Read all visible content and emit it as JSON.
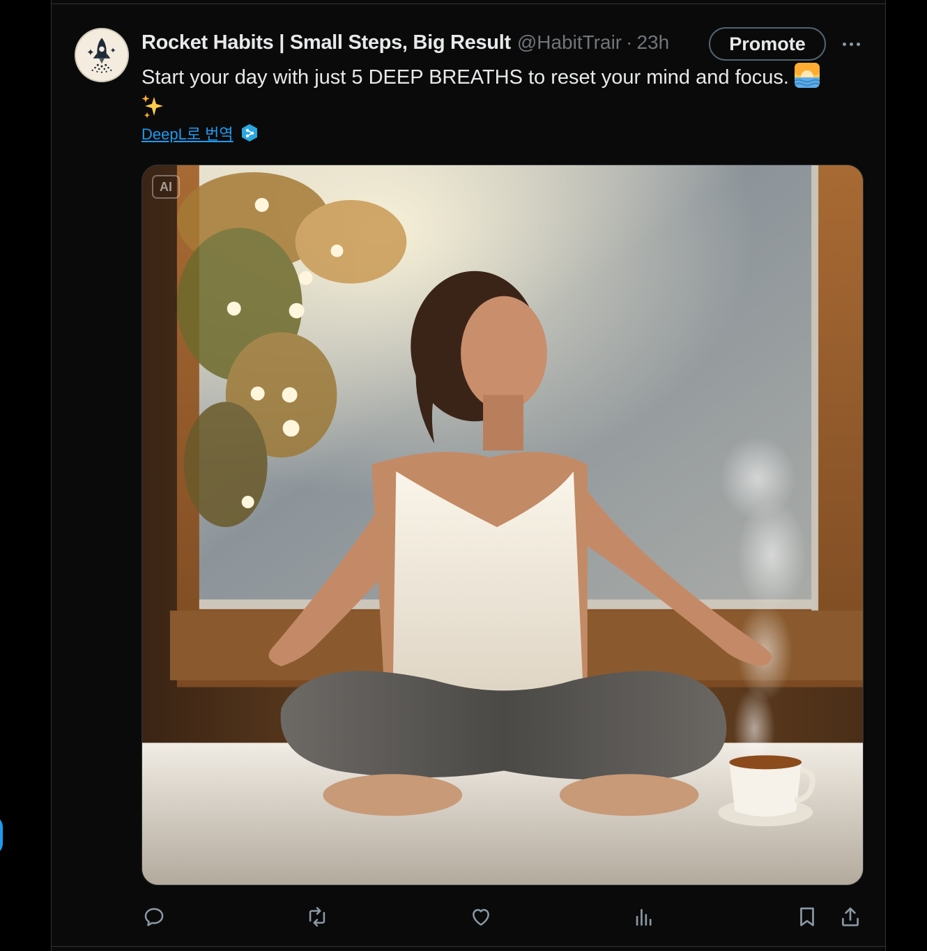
{
  "tweet": {
    "author_name": "Rocket Habits | Small Steps, Big Result",
    "handle": "@HabitTrair",
    "separator": "·",
    "timestamp": "23h",
    "promote_label": "Promote",
    "text": "Start your day with just 5 DEEP BREATHS to reset your mind and focus.",
    "translate_label": "DeepL로 번역",
    "media_badge": "AI"
  },
  "icons": {
    "avatar": "rocket-logo",
    "more": "more-horizontal-icon",
    "emoji_1": "sunrise-emoji",
    "emoji_2": "sparkles-emoji",
    "translate": "deepl-icon",
    "actions": [
      "reply-icon",
      "retweet-icon",
      "like-icon",
      "views-icon",
      "bookmark-icon",
      "share-icon"
    ]
  },
  "colors": {
    "background": "#000000",
    "text": "#e7e9ea",
    "secondary_text": "#71767b",
    "link": "#1d9bf0",
    "border": "#2f3336"
  }
}
